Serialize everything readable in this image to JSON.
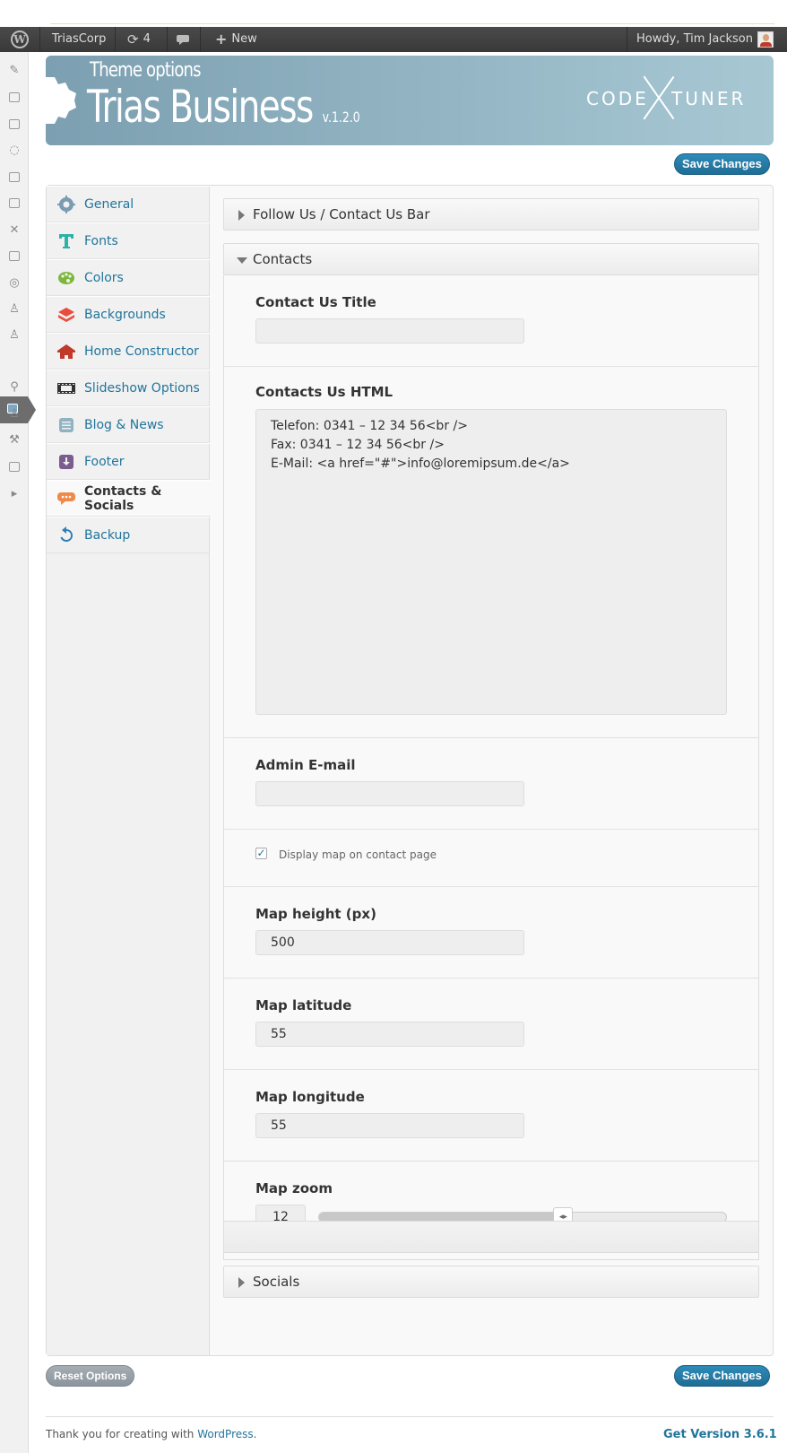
{
  "adminbar": {
    "site_name": "TriasCorp",
    "updates_count": "4",
    "new_label": "New",
    "greeting": "Howdy, Tim Jackson"
  },
  "header": {
    "subtitle": "Theme options",
    "title": "Trias Business",
    "version": "v.1.2.0",
    "logo_left": "CODE",
    "logo_right": "TUNER"
  },
  "buttons": {
    "save_changes": "Save Changes",
    "reset_options": "Reset Options"
  },
  "nav": {
    "items": [
      {
        "label": "General",
        "icon": "gear-icon",
        "color": "#7a9bb0"
      },
      {
        "label": "Fonts",
        "icon": "font-icon",
        "color": "#2bb3a8"
      },
      {
        "label": "Colors",
        "icon": "palette-icon",
        "color": "#7bb83a"
      },
      {
        "label": "Backgrounds",
        "icon": "layers-icon",
        "color": "#e84c3d"
      },
      {
        "label": "Home Constructor",
        "icon": "home-icon",
        "color": "#c0392b"
      },
      {
        "label": "Slideshow Options",
        "icon": "film-icon",
        "color": "#333333"
      },
      {
        "label": "Blog & News",
        "icon": "document-icon",
        "color": "#8fb3c2"
      },
      {
        "label": "Footer",
        "icon": "download-icon",
        "color": "#7a5c8e"
      },
      {
        "label": "Contacts & Socials",
        "icon": "speech-bubble-icon",
        "color": "#f08a4b"
      },
      {
        "label": "Backup",
        "icon": "refresh-icon",
        "color": "#2e7fb8"
      }
    ],
    "active_index": 8
  },
  "sections": {
    "follow_bar": "Follow Us / Contact Us Bar",
    "contacts": "Contacts",
    "socials": "Socials"
  },
  "contacts": {
    "title_label": "Contact Us Title",
    "title_value": "",
    "html_label": "Contacts Us HTML",
    "html_value": "Telefon: 0341 – 12 34 56<br />\nFax: 0341 – 12 34 56<br />\nE-Mail: <a href=\"#\">info@loremipsum.de</a>",
    "admin_email_label": "Admin E-mail",
    "admin_email_value": "",
    "display_map_label": "Display map on contact page",
    "display_map_checked": true,
    "map_height_label": "Map height (px)",
    "map_height_value": "500",
    "map_latitude_label": "Map latitude",
    "map_latitude_value": "55",
    "map_longitude_label": "Map longitude",
    "map_longitude_value": "55",
    "map_zoom_label": "Map zoom",
    "map_zoom_value": "12",
    "map_zoom_fraction": 0.6
  },
  "footer": {
    "thanks_text": "Thank you for creating with",
    "wordpress_link": "WordPress",
    "period": ".",
    "version_link": "Get Version 3.6.1"
  }
}
